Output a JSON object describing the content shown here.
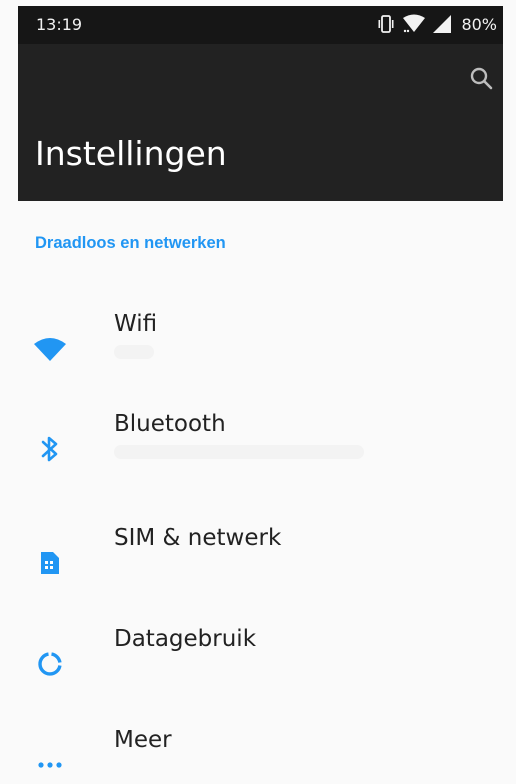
{
  "status_bar": {
    "time": "13:19",
    "battery": "80%",
    "icons": [
      "vibrate-icon",
      "wifi-signal-icon",
      "cell-signal-icon"
    ]
  },
  "app_bar": {
    "title": "Instellingen",
    "search_icon": "search-icon"
  },
  "section": {
    "header": "Draadloos en netwerken"
  },
  "items": [
    {
      "label": "Wifi",
      "icon": "wifi-icon"
    },
    {
      "label": "Bluetooth",
      "icon": "bluetooth-icon"
    },
    {
      "label": "SIM & netwerk",
      "icon": "sim-card-icon"
    },
    {
      "label": "Datagebruik",
      "icon": "data-usage-icon"
    },
    {
      "label": "Meer",
      "icon": "more-icon"
    }
  ],
  "colors": {
    "accent": "#2196f3",
    "status_bar": "#161616",
    "app_bar": "#222222",
    "background": "#fafafa"
  }
}
